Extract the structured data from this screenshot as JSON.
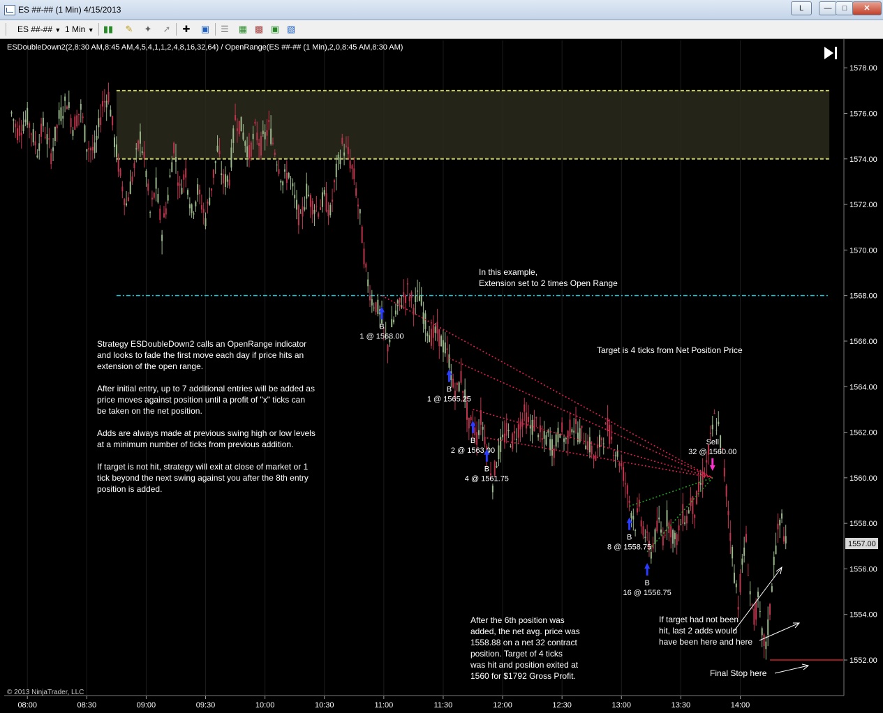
{
  "window": {
    "title": "ES ##-## (1 Min)  4/15/2013",
    "link_button": "L",
    "minimize_icon": "minimize-icon",
    "maximize_icon": "maximize-icon",
    "close_icon": "close-icon"
  },
  "toolbar": {
    "instrument": "ES ##-##",
    "interval": "1 Min",
    "icons": [
      "bar-style-icon",
      "drawing-tool-icon",
      "pin-icon",
      "crosshair-icon",
      "zoom-icon",
      "properties-icon",
      "strategies-icon",
      "indicators-icon",
      "data-box-icon",
      "chart-trader-icon"
    ]
  },
  "chart_data": {
    "type": "candlestick",
    "header": "ESDoubleDown2(2,8:30 AM,8:45 AM,4,5,4,1,1,2,4,8,16,32,64) / OpenRange(ES ##-## (1 Min),2,0,8:45 AM,8:30 AM)",
    "copyright": "© 2013 NinjaTrader, LLC",
    "y_ticks": [
      "1578.00",
      "1576.00",
      "1574.00",
      "1572.00",
      "1570.00",
      "1568.00",
      "1566.00",
      "1564.00",
      "1562.00",
      "1560.00",
      "1558.00",
      "1556.00",
      "1554.00",
      "1552.00"
    ],
    "x_ticks": [
      "08:00",
      "08:30",
      "09:00",
      "09:30",
      "10:00",
      "10:30",
      "11:00",
      "11:30",
      "12:00",
      "12:30",
      "13:00",
      "13:30",
      "14:00"
    ],
    "ylim": [
      1550.5,
      1579.2
    ],
    "xlim": [
      "07:49",
      "14:52"
    ],
    "last_price": "1557.00",
    "colors": {
      "up": "#9ab88a",
      "down": "#c0344e",
      "range_line": "#c8d060",
      "extension_line": "#19c8d8",
      "loss_lines": "#e0204a",
      "profit_lines": "#20a020",
      "buy_arrow": "#2a3cff",
      "sell_arrow": "#ff30d0",
      "stop_line": "#d02020"
    },
    "open_range": {
      "high": 1577.0,
      "low": 1574.0,
      "start": "08:45",
      "end": "14:45"
    },
    "extension_level": {
      "price": 1568.0,
      "start": "08:45",
      "end": "14:45"
    },
    "price_path": [
      [
        "07:52",
        1576.0
      ],
      [
        "07:55",
        1575.2
      ],
      [
        "08:00",
        1575.8
      ],
      [
        "08:05",
        1574.4
      ],
      [
        "08:08",
        1575.5
      ],
      [
        "08:12",
        1574.2
      ],
      [
        "08:16",
        1575.8
      ],
      [
        "08:20",
        1576.6
      ],
      [
        "08:23",
        1575.4
      ],
      [
        "08:27",
        1576.2
      ],
      [
        "08:30",
        1574.6
      ],
      [
        "08:34",
        1574.3
      ],
      [
        "08:38",
        1576.4
      ],
      [
        "08:41",
        1576.8
      ],
      [
        "08:44",
        1574.8
      ],
      [
        "08:47",
        1573.2
      ],
      [
        "08:50",
        1572.0
      ],
      [
        "08:54",
        1573.6
      ],
      [
        "08:57",
        1575.0
      ],
      [
        "09:00",
        1573.4
      ],
      [
        "09:02",
        1571.6
      ],
      [
        "09:05",
        1572.8
      ],
      [
        "09:08",
        1570.8
      ],
      [
        "09:11",
        1572.4
      ],
      [
        "09:14",
        1574.6
      ],
      [
        "09:17",
        1572.6
      ],
      [
        "09:20",
        1573.5
      ],
      [
        "09:23",
        1571.6
      ],
      [
        "09:26",
        1572.6
      ],
      [
        "09:30",
        1571.4
      ],
      [
        "09:33",
        1572.8
      ],
      [
        "09:36",
        1574.4
      ],
      [
        "09:39",
        1573.0
      ],
      [
        "09:42",
        1573.2
      ],
      [
        "09:45",
        1575.8
      ],
      [
        "09:48",
        1575.4
      ],
      [
        "09:52",
        1574.2
      ],
      [
        "09:55",
        1575.2
      ],
      [
        "09:58",
        1574.6
      ],
      [
        "10:02",
        1575.4
      ],
      [
        "10:05",
        1574.4
      ],
      [
        "10:09",
        1573.0
      ],
      [
        "10:12",
        1573.4
      ],
      [
        "10:15",
        1572.2
      ],
      [
        "10:18",
        1571.2
      ],
      [
        "10:21",
        1572.6
      ],
      [
        "10:24",
        1572.0
      ],
      [
        "10:27",
        1571.8
      ],
      [
        "10:30",
        1572.3
      ],
      [
        "10:33",
        1571.6
      ],
      [
        "10:36",
        1573.4
      ],
      [
        "10:39",
        1574.6
      ],
      [
        "10:42",
        1574.2
      ],
      [
        "10:45",
        1573.2
      ],
      [
        "10:48",
        1571.4
      ],
      [
        "10:51",
        1569.0
      ],
      [
        "10:54",
        1567.8
      ],
      [
        "10:56",
        1567.6
      ],
      [
        "10:58",
        1567.2
      ],
      [
        "11:00",
        1566.4
      ],
      [
        "11:02",
        1565.8
      ],
      [
        "11:04",
        1566.6
      ],
      [
        "11:06",
        1567.2
      ],
      [
        "11:09",
        1567.8
      ],
      [
        "11:12",
        1568.2
      ],
      [
        "11:15",
        1567.6
      ],
      [
        "11:18",
        1568.0
      ],
      [
        "11:21",
        1566.8
      ],
      [
        "11:24",
        1566.2
      ],
      [
        "11:27",
        1566.4
      ],
      [
        "11:30",
        1565.8
      ],
      [
        "11:33",
        1565.2
      ],
      [
        "11:35",
        1564.0
      ],
      [
        "11:37",
        1563.8
      ],
      [
        "11:39",
        1564.4
      ],
      [
        "11:41",
        1563.6
      ],
      [
        "11:43",
        1562.2
      ],
      [
        "11:45",
        1562.4
      ],
      [
        "11:47",
        1561.8
      ],
      [
        "11:49",
        1562.6
      ],
      [
        "11:51",
        1561.8
      ],
      [
        "11:53",
        1561.0
      ],
      [
        "11:55",
        1559.8
      ],
      [
        "11:57",
        1560.8
      ],
      [
        "11:59",
        1561.4
      ],
      [
        "12:02",
        1562.0
      ],
      [
        "12:05",
        1561.6
      ],
      [
        "12:08",
        1562.2
      ],
      [
        "12:11",
        1562.8
      ],
      [
        "12:14",
        1562.2
      ],
      [
        "12:17",
        1562.4
      ],
      [
        "12:20",
        1561.6
      ],
      [
        "12:23",
        1561.8
      ],
      [
        "12:26",
        1561.2
      ],
      [
        "12:29",
        1562.2
      ],
      [
        "12:32",
        1561.6
      ],
      [
        "12:35",
        1562.4
      ],
      [
        "12:38",
        1562.0
      ],
      [
        "12:41",
        1561.8
      ],
      [
        "12:44",
        1561.4
      ],
      [
        "12:47",
        1560.8
      ],
      [
        "12:50",
        1561.8
      ],
      [
        "12:53",
        1562.2
      ],
      [
        "12:56",
        1561.4
      ],
      [
        "12:59",
        1560.8
      ],
      [
        "13:01",
        1560.2
      ],
      [
        "13:03",
        1559.4
      ],
      [
        "13:05",
        1558.6
      ],
      [
        "13:07",
        1558.0
      ],
      [
        "13:09",
        1558.6
      ],
      [
        "13:11",
        1557.8
      ],
      [
        "13:13",
        1557.2
      ],
      [
        "13:15",
        1556.8
      ],
      [
        "13:17",
        1557.4
      ],
      [
        "13:19",
        1558.0
      ],
      [
        "13:21",
        1557.4
      ],
      [
        "13:23",
        1558.2
      ],
      [
        "13:25",
        1557.8
      ],
      [
        "13:27",
        1557.2
      ],
      [
        "13:29",
        1557.6
      ],
      [
        "13:31",
        1558.4
      ],
      [
        "13:33",
        1558.2
      ],
      [
        "13:35",
        1559.0
      ],
      [
        "13:37",
        1558.6
      ],
      [
        "13:39",
        1559.4
      ],
      [
        "13:41",
        1560.0
      ],
      [
        "13:43",
        1560.6
      ],
      [
        "13:45",
        1561.6
      ],
      [
        "13:47",
        1562.6
      ],
      [
        "13:49",
        1562.2
      ],
      [
        "13:51",
        1561.0
      ],
      [
        "13:53",
        1559.4
      ],
      [
        "13:55",
        1557.6
      ],
      [
        "13:57",
        1555.8
      ],
      [
        "13:59",
        1554.6
      ],
      [
        "14:01",
        1556.2
      ],
      [
        "14:03",
        1557.2
      ],
      [
        "14:05",
        1555.0
      ],
      [
        "14:07",
        1553.8
      ],
      [
        "14:09",
        1554.6
      ],
      [
        "14:11",
        1553.0
      ],
      [
        "14:13",
        1552.6
      ],
      [
        "14:15",
        1554.2
      ],
      [
        "14:17",
        1556.4
      ],
      [
        "14:19",
        1557.6
      ],
      [
        "14:21",
        1558.2
      ],
      [
        "14:23",
        1557.0
      ]
    ],
    "entries": [
      {
        "time": "10:59",
        "price": 1568.0,
        "marker": "B",
        "label": "1 @ 1568.00"
      },
      {
        "time": "11:33",
        "price": 1565.25,
        "marker": "B",
        "label": "1 @ 1565.25"
      },
      {
        "time": "11:45",
        "price": 1563.0,
        "marker": "B",
        "label": "2 @ 1563.00"
      },
      {
        "time": "11:52",
        "price": 1561.75,
        "marker": "B",
        "label": "4 @ 1561.75"
      },
      {
        "time": "13:04",
        "price": 1558.75,
        "marker": "B",
        "label": "8 @ 1558.75"
      },
      {
        "time": "13:13",
        "price": 1556.75,
        "marker": "B",
        "label": "16 @ 1556.75"
      }
    ],
    "exit": {
      "time": "13:46",
      "price": 1560.0,
      "marker": "Sell",
      "label": "32 @ 1560.00"
    },
    "loss_lines": [
      {
        "from": [
          "10:59",
          1568.0
        ],
        "to": [
          "13:46",
          1560.0
        ]
      },
      {
        "from": [
          "11:33",
          1565.25
        ],
        "to": [
          "13:46",
          1560.0
        ]
      },
      {
        "from": [
          "11:45",
          1563.0
        ],
        "to": [
          "13:46",
          1560.0
        ]
      },
      {
        "from": [
          "11:52",
          1561.75
        ],
        "to": [
          "13:46",
          1560.0
        ]
      }
    ],
    "profit_lines": [
      {
        "from": [
          "13:04",
          1558.75
        ],
        "to": [
          "13:46",
          1560.0
        ]
      },
      {
        "from": [
          "13:13",
          1556.75
        ],
        "to": [
          "13:46",
          1560.0
        ]
      }
    ],
    "final_stop": {
      "price": 1552.0,
      "start": "14:15",
      "end": "14:45"
    }
  },
  "annotations": {
    "extension_note_1": "In this example,",
    "extension_note_2": "Extension set to 2 times Open Range",
    "target_note": "Target is 4 ticks from Net Position Price",
    "strategy": [
      "Strategy ESDoubleDown2 calls an OpenRange indicator",
      "and looks to fade the first move each day if price hits an",
      "extension of the open range.",
      "",
      "After initial entry, up to 7 additional entries will be added as",
      "price moves against position until a profit of \"x\" ticks can",
      "be taken on the net position.",
      "",
      "Adds are always made at previous swing high or low levels",
      "at a minimum number of ticks from previous addition.",
      "",
      "If target is not hit, strategy will exit at close of market or 1",
      "tick beyond the next swing against you after the 8th entry",
      "position is added."
    ],
    "sixth_position": [
      "After the 6th position was",
      "added, the net avg. price was",
      "1558.88 on a net 32 contract",
      "position.  Target of 4 ticks",
      "was hit and position exited at",
      "1560 for $1792 Gross Profit."
    ],
    "last_adds": [
      "If target had not been",
      "hit, last 2 adds would",
      "have been here and here"
    ],
    "final_stop": "Final Stop here"
  }
}
